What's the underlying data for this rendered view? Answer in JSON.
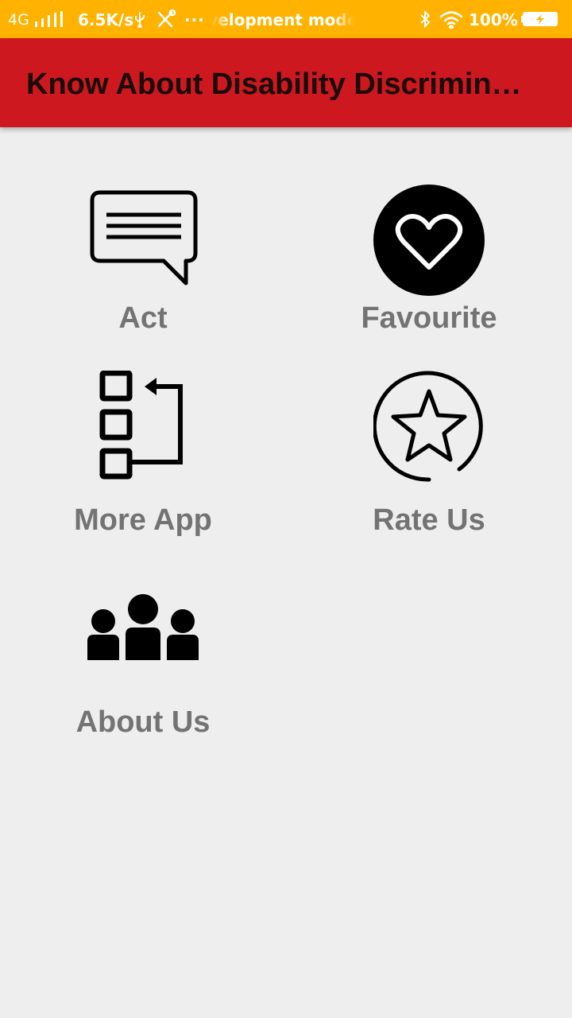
{
  "status_bar": {
    "network": "4G",
    "speed": "6.5K/s",
    "more_dots": "···",
    "notification_text": "Development mode",
    "battery_percent": "100%",
    "icons": [
      "signal-icon",
      "usb-icon",
      "tools-icon",
      "bluetooth-icon",
      "wifi-icon",
      "battery-charging-icon"
    ]
  },
  "app_bar": {
    "title": "Know About Disability Discriminat…"
  },
  "menu": {
    "items": [
      {
        "label": "Act",
        "icon": "message-icon"
      },
      {
        "label": "Favourite",
        "icon": "heart-icon"
      },
      {
        "label": "More App",
        "icon": "more-apps-icon"
      },
      {
        "label": "Rate Us",
        "icon": "star-icon"
      },
      {
        "label": "About Us",
        "icon": "people-icon"
      }
    ]
  },
  "colors": {
    "status_bar": "#ffb300",
    "app_bar": "#cc181e",
    "background": "#eeeeee",
    "label": "#737373",
    "icon": "#000000"
  }
}
